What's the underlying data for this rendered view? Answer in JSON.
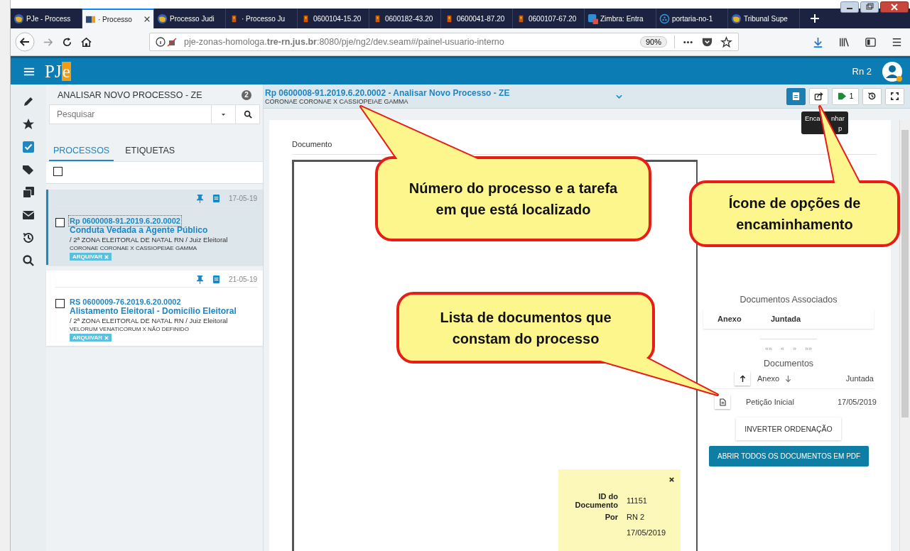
{
  "browser": {
    "tabs": [
      {
        "label": "PJe - Process",
        "kind": "globe",
        "selected": false
      },
      {
        "label": "· Processo",
        "kind": "pje",
        "selected": true
      },
      {
        "label": "Processo Judi",
        "kind": "globe",
        "selected": false
      },
      {
        "label": "· Processo Ju",
        "kind": "flag",
        "selected": false
      },
      {
        "label": "0600104-15.20",
        "kind": "flag",
        "selected": false
      },
      {
        "label": "0600182-43.20",
        "kind": "flag",
        "selected": false
      },
      {
        "label": "0600041-87.20",
        "kind": "flag",
        "selected": false
      },
      {
        "label": "0600107-67.20",
        "kind": "flag",
        "selected": false
      },
      {
        "label": "Zimbra: Entra",
        "kind": "zimbra",
        "selected": false
      },
      {
        "label": "portaria-no-1",
        "kind": "portaria",
        "selected": false
      },
      {
        "label": "Tribunal Supe",
        "kind": "globe",
        "selected": false
      }
    ],
    "address": "pje-zonas-homologa.**tre-rn.jus.br**:8080/pje/ng2/dev.seam#/painel-usuario-interno",
    "zoom": "90%"
  },
  "app": {
    "logo": "PJe",
    "user": "Rn 2"
  },
  "rail": [
    {
      "kind": "pencil",
      "selected": false
    },
    {
      "kind": "star",
      "selected": false
    },
    {
      "kind": "check",
      "selected": true
    },
    {
      "kind": "tags",
      "selected": false
    },
    {
      "kind": "copy",
      "selected": false
    },
    {
      "kind": "envelope",
      "selected": false
    },
    {
      "kind": "history",
      "selected": false
    },
    {
      "kind": "search",
      "selected": false
    }
  ],
  "task": {
    "title": "ANALISAR NOVO PROCESSO - ZE",
    "count": "2",
    "search_placeholder": "Pesquisar",
    "select_all_checked": false
  },
  "list_tabs": [
    {
      "label": "PROCESSOS",
      "selected": true
    },
    {
      "label": "ETIQUETAS",
      "selected": false
    }
  ],
  "processes": [
    {
      "date": "17-05-19",
      "number": "Rp 0600008-91.2019.6.20.0002",
      "class": "Conduta Vedada a Agente Público",
      "court": "/ 2ª ZONA ELEITORAL DE NATAL RN / Juiz Eleitoral",
      "parties": "CORONAE CORONAE X CASSIOPEIAE GAMMA",
      "tag": "ARQUIVAR",
      "selected": true,
      "checked": false
    },
    {
      "date": "21-05-19",
      "number": "RS 0600009-76.2019.6.20.0002",
      "class": "Alistamento Eleitoral - Domicílio Eleitoral",
      "court": "/ 2ª ZONA ELEITORAL DE NATAL RN / Juiz Eleitoral",
      "parties": "VELORUM VENATICORUM X NÃO DEFINIDO",
      "tag": "ARQUIVAR",
      "selected": false,
      "checked": false
    }
  ],
  "header": {
    "title": "Rp 0600008-91.2019.6.20.0002 - Analisar Novo Processo - ZE",
    "subtitle": "CORONAE CORONAE X CASSIOPEIAE GAMMA",
    "tags_count": "1",
    "tooltip_fragments": [
      "Enca",
      "nhar",
      "p"
    ]
  },
  "document": {
    "label": "Documento",
    "associated_title": "Documentos Associados",
    "associated_columns": [
      "Anexo",
      "Juntada"
    ],
    "pager": [
      "««",
      "«",
      "»",
      "»»"
    ],
    "documents_title": "Documentos",
    "doc_columns": [
      "Anexo",
      "Juntada"
    ],
    "documents": [
      {
        "name": "Petição Inicial",
        "date": "17/05/2019"
      }
    ],
    "invert_button": "INVERTER ORDENAÇÃO",
    "open_all_button": "ABRIR TODOS OS DOCUMENTOS EM PDF"
  },
  "info_popup": {
    "rows": [
      {
        "label": "ID do Documento",
        "value": "11151"
      },
      {
        "label": "Por",
        "value": "RN 2"
      },
      {
        "value": "17/05/2019"
      }
    ]
  },
  "callouts": [
    {
      "text": "Número do processo e a tarefa em que está localizado"
    },
    {
      "text": "Ícone de opções de encaminhamento"
    },
    {
      "text": "Lista de documentos que constam do processo"
    }
  ]
}
